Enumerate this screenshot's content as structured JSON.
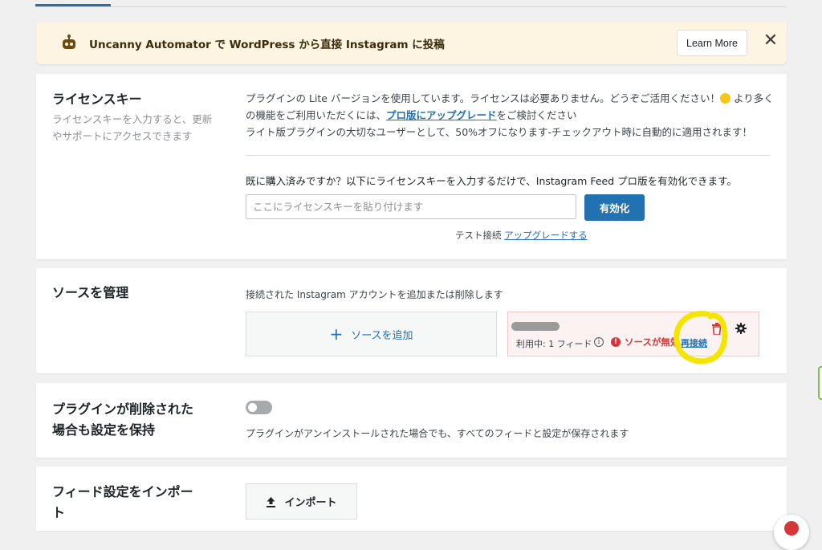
{
  "notice": {
    "text": "Uncanny Automator で WordPress から直接 Instagram に投稿",
    "learn_more": "Learn More",
    "close": "✕"
  },
  "license": {
    "title": "ライセンスキー",
    "desc": "ライセンスキーを入力すると、更新やサポートにアクセスできます",
    "line1_a": "プラグインの Lite バージョンを使用しています。ライセンスは必要ありません。どうぞご活用ください！",
    "line1_b": "より多くの機能をご利用いただくには、",
    "upgrade_link": "プロ版にアップグレード",
    "line1_c": "をご検討ください",
    "line2": "ライト版プラグインの大切なユーザーとして、50%オフになります-チェックアウト時に自動的に適用されます！",
    "question": "既に購入済みですか？以下にライセンスキーを入力するだけで、Instagram Feed プロ版を有効化できます。",
    "input_placeholder": "ここにライセンスキーを貼り付けます",
    "activate": "有効化",
    "test_label": "テスト接続",
    "test_link": "アップグレードする"
  },
  "sources": {
    "title": "ソースを管理",
    "desc": "接続された Instagram アカウントを追加または削除します",
    "add_plus": "+",
    "add_label": "ソースを追加",
    "item": {
      "usage": "利用中: 1 フィード",
      "info": "i",
      "error_mark": "!",
      "error": "ソースが無効",
      "reconnect": "再接続"
    },
    "highlight_color": "#f5e400"
  },
  "preserve": {
    "title": "プラグインが削除された場合も設定を保持",
    "desc": "プラグインがアンインストールされた場合でも、すべてのフィードと設定が保存されます",
    "enabled": false
  },
  "import": {
    "title": "フィード設定をインポート",
    "button": "インポート"
  },
  "colors": {
    "accent": "#2271b1",
    "error": "#d63638",
    "notice_bg": "#fdf4e1"
  }
}
